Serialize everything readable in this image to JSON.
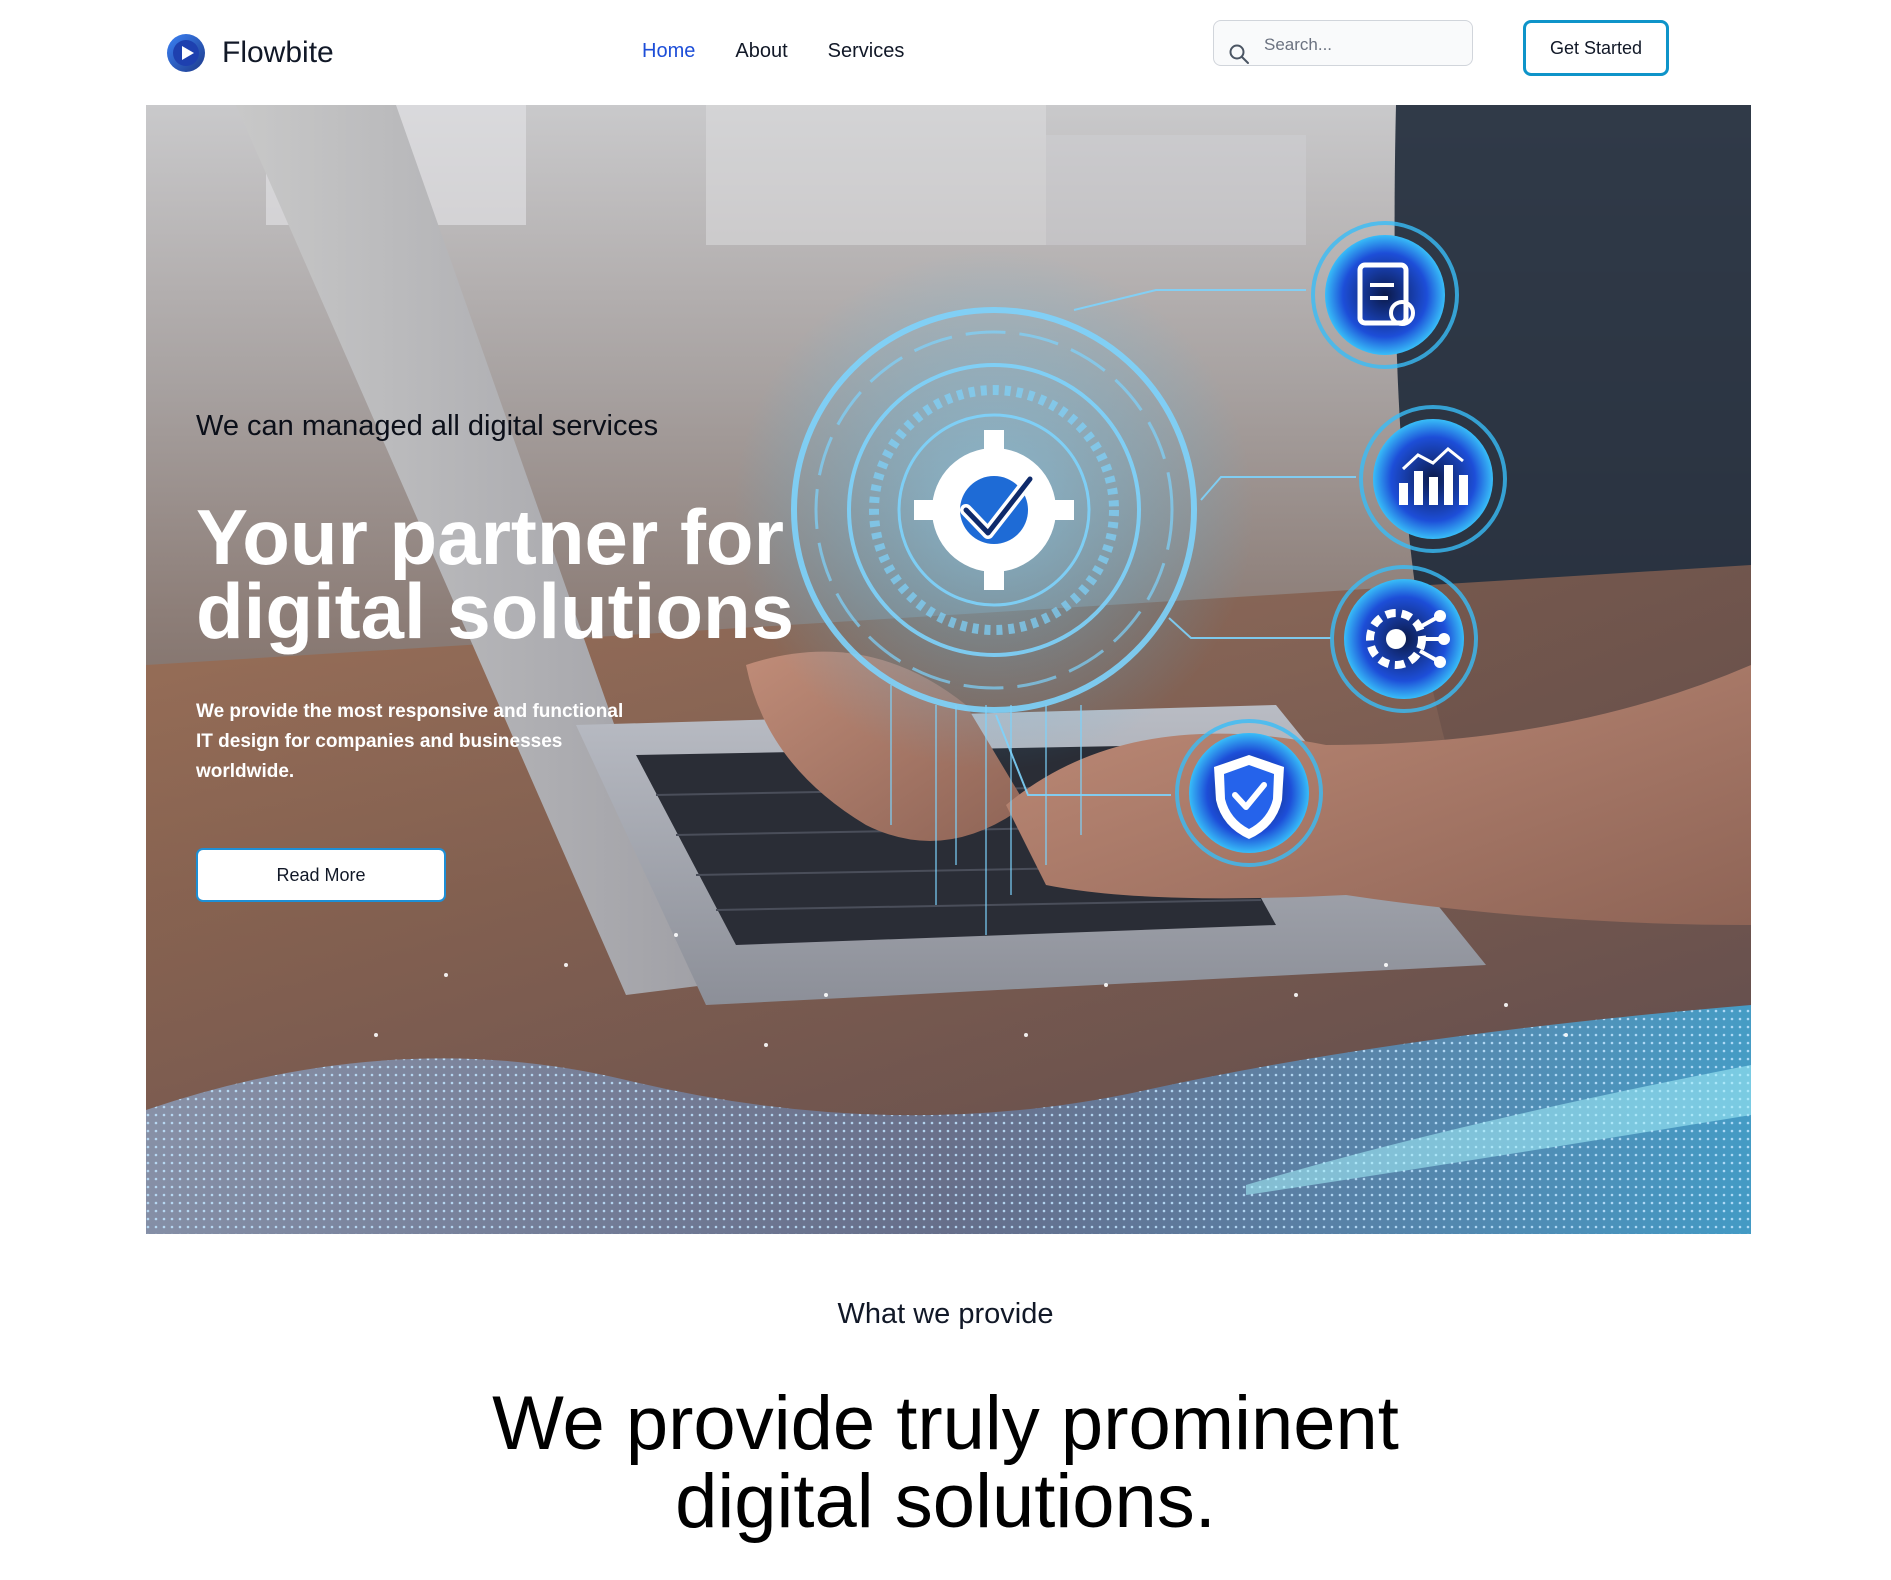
{
  "brand": {
    "name": "Flowbite",
    "logo_icon": "play-circle-icon",
    "accent": "#1d4ed8"
  },
  "nav": {
    "items": [
      {
        "label": "Home",
        "active": true
      },
      {
        "label": "About",
        "active": false
      },
      {
        "label": "Services",
        "active": false
      }
    ]
  },
  "search": {
    "placeholder": "Search...",
    "value": "",
    "icon": "search-icon"
  },
  "header": {
    "cta_label": "Get Started",
    "cta_border": "#0e94c9"
  },
  "hero": {
    "eyebrow": "We can managed all digital services",
    "title": "Your partner for digital solutions",
    "description": "We provide the most responsive and functional IT design for companies and businesses worldwide.",
    "button_label": "Read More",
    "glow_color": "#38bdf8",
    "icons": [
      "gear-check-icon",
      "clipboard-gear-icon",
      "bar-chart-icon",
      "gear-circuit-icon",
      "shield-check-icon"
    ]
  },
  "services": {
    "eyebrow": "What we provide",
    "title": "We provide truly prominent digital solutions."
  }
}
